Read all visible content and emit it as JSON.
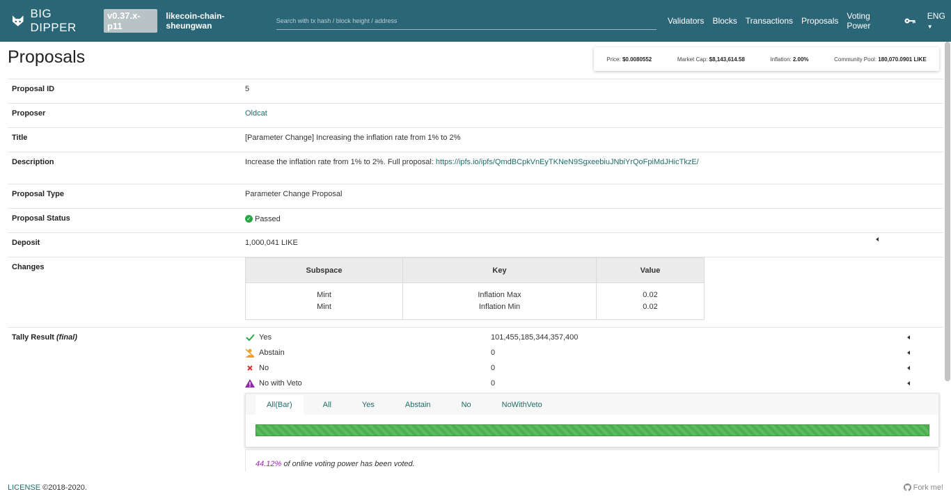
{
  "header": {
    "brand": "BIG DIPPER",
    "version": "v0.37.x-p11",
    "chain": "likecoin-chain-sheungwan",
    "search_placeholder": "Search with tx hash / block height / address",
    "nav": [
      "Validators",
      "Blocks",
      "Transactions",
      "Proposals",
      "Voting Power"
    ],
    "lang": "ENG"
  },
  "page": {
    "title": "Proposals"
  },
  "stats": {
    "price_label": "Price:",
    "price": "$0.0080552",
    "mcap_label": "Market Cap:",
    "mcap": "$8,143,614.58",
    "inflation_label": "Inflation:",
    "inflation": "2.00%",
    "pool_label": "Community Pool:",
    "pool": "180,070.0901 LIKE"
  },
  "proposal": {
    "id_label": "Proposal ID",
    "id": "5",
    "proposer_label": "Proposer",
    "proposer": "Oldcat",
    "title_label": "Title",
    "title": "[Parameter Change] Increasing the inflation rate from 1% to 2%",
    "desc_label": "Description",
    "desc": "Increase the inflation rate from 1% to 2%. Full proposal: ",
    "desc_link": "https://ipfs.io/ipfs/QmdBCpkVnEyTKNeN9SgxeebiuJNbiYrQoFpiMdJHicTkzE/",
    "type_label": "Proposal Type",
    "type": "Parameter Change Proposal",
    "status_label": "Proposal Status",
    "status": "Passed",
    "deposit_label": "Deposit",
    "deposit": "1,000,041 LIKE",
    "changes_label": "Changes",
    "changes_headers": [
      "Subspace",
      "Key",
      "Value"
    ],
    "changes_subspace": [
      "Mint",
      "Mint"
    ],
    "changes_key": [
      "Inflation Max",
      "Inflation Min"
    ],
    "changes_value": [
      "0.02",
      "0.02"
    ]
  },
  "tally": {
    "label": "Tally Result",
    "label_final": "(final)",
    "rows": [
      {
        "label": "Yes",
        "value": "101,455,185,344,357,400"
      },
      {
        "label": "Abstain",
        "value": "0"
      },
      {
        "label": "No",
        "value": "0"
      },
      {
        "label": "No with Veto",
        "value": "0"
      }
    ],
    "tabs": [
      "All(Bar)",
      "All",
      "Yes",
      "Abstain",
      "No",
      "NoWithVeto"
    ],
    "yes_fraction": 1.0,
    "voted_pct": "44.12%",
    "voted_text": " of online voting power has been voted."
  },
  "footer": {
    "license": "LICENSE",
    "copyright": " ©2018-2020.",
    "fork": "Fork me!"
  },
  "colors": {
    "header": "#2b6677",
    "link": "#1f6b6b",
    "yes": "#29a745",
    "abstain": "#f0a030",
    "no": "#d9302c",
    "veto": "#8e2aa8"
  }
}
